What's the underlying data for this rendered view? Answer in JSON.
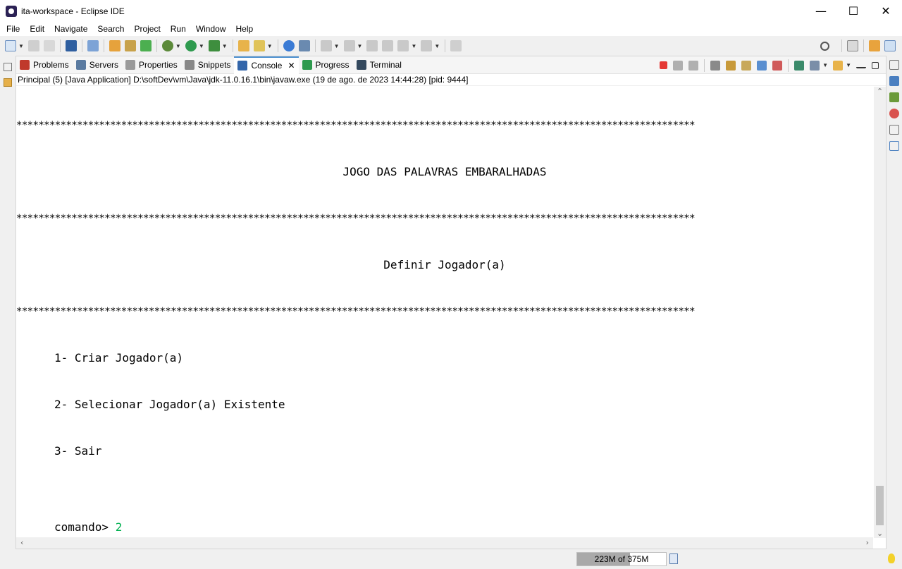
{
  "window": {
    "title": "ita-workspace - Eclipse IDE"
  },
  "menu": [
    "File",
    "Edit",
    "Navigate",
    "Search",
    "Project",
    "Run",
    "Window",
    "Help"
  ],
  "tabs": [
    {
      "label": "Problems",
      "icon": "problems-icon",
      "color": "#c0392b"
    },
    {
      "label": "Servers",
      "icon": "servers-icon",
      "color": "#5a7aa0"
    },
    {
      "label": "Properties",
      "icon": "properties-icon",
      "color": "#777777"
    },
    {
      "label": "Snippets",
      "icon": "snippets-icon",
      "color": "#888888"
    },
    {
      "label": "Console",
      "icon": "console-icon",
      "color": "#3366aa",
      "active": true
    },
    {
      "label": "Progress",
      "icon": "progress-icon",
      "color": "#2e9a4e"
    },
    {
      "label": "Terminal",
      "icon": "terminal-icon",
      "color": "#34495e"
    }
  ],
  "console": {
    "header": "Principal (5) [Java Application] D:\\softDev\\vm\\Java\\jdk-11.0.16.1\\bin\\javaw.exe  (19 de ago. de 2023 14:44:28) [pid: 9444]",
    "stars": "***************************************************************************************************************************",
    "game_title": "JOGO DAS PALAVRAS EMBARALHADAS",
    "section_title": "Definir Jogador(a)",
    "options": [
      "1- Criar Jogador(a)",
      "2- Selecionar Jogador(a) Existente",
      "3- Sair"
    ],
    "prompt": "comando> ",
    "input": "2"
  },
  "status": {
    "heap": "223M of 375M",
    "heap_used_fraction": 0.595
  },
  "colors": {
    "accent": "#4d90d0",
    "input": "#00b050",
    "stop": "#e53935"
  }
}
